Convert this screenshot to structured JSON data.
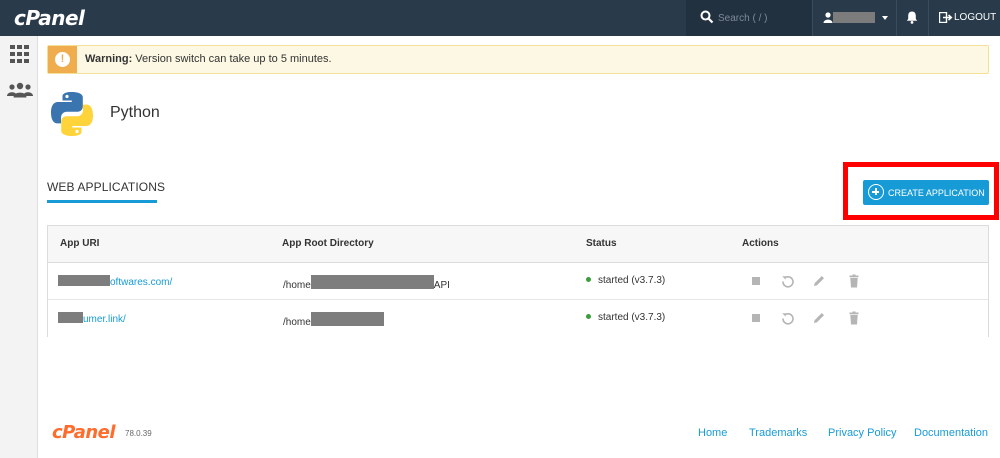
{
  "header": {
    "logo": "cPanel",
    "search_placeholder": "Search ( / )",
    "logout_label": "LOGOUT"
  },
  "warning": {
    "strong": "Warning:",
    "text": " Version switch can take up to 5 minutes."
  },
  "page": {
    "title": "Python"
  },
  "tabs": {
    "web_apps": "WEB APPLICATIONS"
  },
  "create_button": {
    "label": "CREATE APPLICATION"
  },
  "table": {
    "headers": {
      "uri": "App URI",
      "root": "App Root Directory",
      "status": "Status",
      "actions": "Actions"
    },
    "rows": [
      {
        "uri_visible": "oftwares.com/",
        "root_prefix": "/home",
        "root_suffix": "API",
        "status": "started (v3.7.3)"
      },
      {
        "uri_visible": "umer.link/",
        "root_prefix": "/home",
        "root_suffix": "",
        "status": "started (v3.7.3)"
      }
    ]
  },
  "footer": {
    "logo": "cPanel",
    "version": "78.0.39",
    "links": [
      "Home",
      "Trademarks",
      "Privacy Policy",
      "Documentation"
    ]
  },
  "colors": {
    "topbar": "#293a4a",
    "accent": "#179bd7",
    "warning_bg": "#fcf8e3",
    "warning_accent": "#f0ad4e",
    "status_ok": "#3c9d3c",
    "highlight": "#ff0000",
    "footer_logo": "#ff6c2c"
  }
}
